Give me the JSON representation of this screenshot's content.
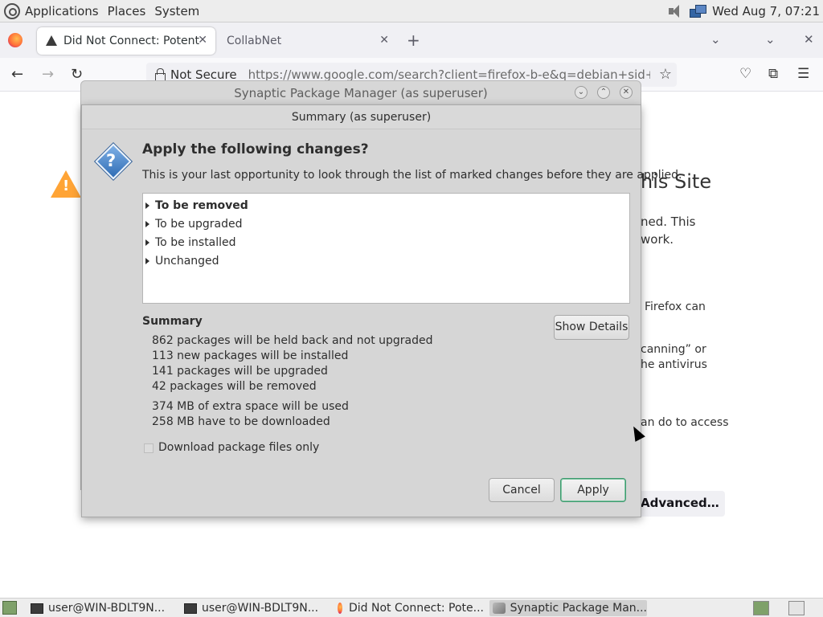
{
  "top_panel": {
    "menus": [
      "Applications",
      "Places",
      "System"
    ],
    "clock": "Wed Aug 7, 07:21"
  },
  "browser": {
    "tabs": [
      {
        "title": "Did Not Connect: Potential Security Issue",
        "active": true
      },
      {
        "title": "CollabNet",
        "active": false
      }
    ],
    "security_label": "Not Secure",
    "url": "https://www.google.com/search?client=firefox-b-e&q=debian+sid+source"
  },
  "error_page": {
    "heading_fragment": "his Site",
    "lines": [
      "ned. This",
      "work.",
      "Firefox can",
      "canning” or",
      "he antivirus",
      "an do to access"
    ],
    "advanced_label": "Advanced…"
  },
  "synaptic_window": {
    "title": "Synaptic Package Manager  (as superuser)"
  },
  "summary_dialog": {
    "title": "Summary (as superuser)",
    "heading": "Apply the following changes?",
    "description": "This is your last opportunity to look through the list of marked changes before they are applied.",
    "tree_items": [
      {
        "label": "To be removed",
        "bold": true
      },
      {
        "label": "To be upgraded",
        "bold": false
      },
      {
        "label": "To be installed",
        "bold": false
      },
      {
        "label": "Unchanged",
        "bold": false
      }
    ],
    "summary_heading": "Summary",
    "show_details_label": "Show Details",
    "summary_lines": [
      "862 packages will be held back and not upgraded",
      "113 new packages will be installed",
      "141 packages will be upgraded",
      "42 packages will be removed"
    ],
    "space_lines": [
      "374 MB of extra space will be used",
      "258 MB have to be downloaded"
    ],
    "download_only_label": "Download package files only",
    "download_only_checked": false,
    "cancel_label": "Cancel",
    "apply_label": "Apply"
  },
  "taskbar": {
    "tasks": [
      {
        "title": "user@WIN-BDLT9N...",
        "icon": "terminal-icon"
      },
      {
        "title": "user@WIN-BDLT9N...",
        "icon": "terminal-icon"
      },
      {
        "title": "Did Not Connect: Pote...",
        "icon": "firefox-icon"
      },
      {
        "title": "Synaptic Package Man...",
        "icon": "synaptic-icon"
      }
    ]
  }
}
